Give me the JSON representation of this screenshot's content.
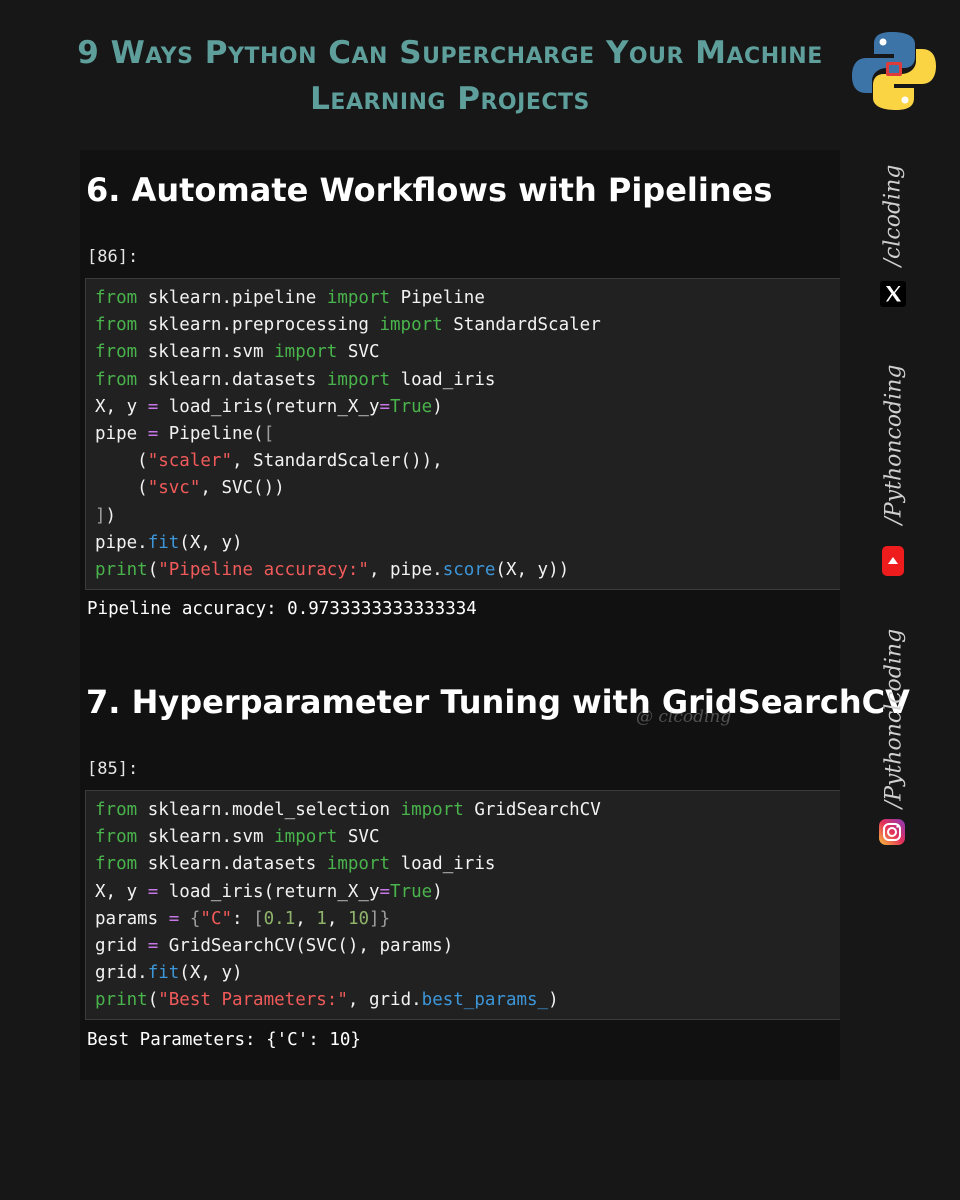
{
  "header": {
    "title": "9 Ways Python Can Supercharge Your Machine Learning Projects"
  },
  "sections": [
    {
      "heading": "6. Automate Workflows with Pipelines",
      "prompt": "[86]:",
      "output": "Pipeline accuracy: 0.9733333333333334",
      "code_lines": [
        [
          {
            "t": "from",
            "c": "kw"
          },
          {
            "t": " sklearn.pipeline "
          },
          {
            "t": "import",
            "c": "kw"
          },
          {
            "t": " Pipeline"
          }
        ],
        [
          {
            "t": "from",
            "c": "kw"
          },
          {
            "t": " sklearn.preprocessing "
          },
          {
            "t": "import",
            "c": "kw"
          },
          {
            "t": " StandardScaler"
          }
        ],
        [
          {
            "t": "from",
            "c": "kw"
          },
          {
            "t": " sklearn.svm "
          },
          {
            "t": "import",
            "c": "kw"
          },
          {
            "t": " SVC"
          }
        ],
        [
          {
            "t": "from",
            "c": "kw"
          },
          {
            "t": " sklearn.datasets "
          },
          {
            "t": "import",
            "c": "kw"
          },
          {
            "t": " load_iris"
          }
        ],
        [
          {
            "t": "X, y "
          },
          {
            "t": "=",
            "c": "op"
          },
          {
            "t": " load_iris(return_X_y"
          },
          {
            "t": "=",
            "c": "op"
          },
          {
            "t": "True",
            "c": "bool"
          },
          {
            "t": ")"
          }
        ],
        [
          {
            "t": "pipe "
          },
          {
            "t": "=",
            "c": "op"
          },
          {
            "t": " Pipeline("
          },
          {
            "t": "[",
            "c": "paren"
          }
        ],
        [
          {
            "t": "    ("
          },
          {
            "t": "\"scaler\"",
            "c": "str"
          },
          {
            "t": ", StandardScaler()),"
          }
        ],
        [
          {
            "t": "    ("
          },
          {
            "t": "\"svc\"",
            "c": "str"
          },
          {
            "t": ", SVC())"
          }
        ],
        [
          {
            "t": "]",
            "c": "paren"
          },
          {
            "t": ")"
          }
        ],
        [
          {
            "t": "pipe."
          },
          {
            "t": "fit",
            "c": "fn"
          },
          {
            "t": "(X, y)"
          }
        ],
        [
          {
            "t": "print",
            "c": "kw"
          },
          {
            "t": "("
          },
          {
            "t": "\"Pipeline accuracy:\"",
            "c": "str"
          },
          {
            "t": ", pipe."
          },
          {
            "t": "score",
            "c": "fn"
          },
          {
            "t": "(X, y))"
          }
        ]
      ]
    },
    {
      "heading": "7. Hyperparameter Tuning with GridSearchCV",
      "prompt": "[85]:",
      "output": "Best Parameters: {'C': 10}",
      "code_lines": [
        [
          {
            "t": "from",
            "c": "kw"
          },
          {
            "t": " sklearn.model_selection "
          },
          {
            "t": "import",
            "c": "kw"
          },
          {
            "t": " GridSearchCV"
          }
        ],
        [
          {
            "t": "from",
            "c": "kw"
          },
          {
            "t": " sklearn.svm "
          },
          {
            "t": "import",
            "c": "kw"
          },
          {
            "t": " SVC"
          }
        ],
        [
          {
            "t": "from",
            "c": "kw"
          },
          {
            "t": " sklearn.datasets "
          },
          {
            "t": "import",
            "c": "kw"
          },
          {
            "t": " load_iris"
          }
        ],
        [
          {
            "t": "X, y "
          },
          {
            "t": "=",
            "c": "op"
          },
          {
            "t": " load_iris(return_X_y"
          },
          {
            "t": "=",
            "c": "op"
          },
          {
            "t": "True",
            "c": "bool"
          },
          {
            "t": ")"
          }
        ],
        [
          {
            "t": "params "
          },
          {
            "t": "=",
            "c": "op"
          },
          {
            "t": " "
          },
          {
            "t": "{",
            "c": "paren"
          },
          {
            "t": "\"C\"",
            "c": "str"
          },
          {
            "t": ": "
          },
          {
            "t": "[",
            "c": "paren"
          },
          {
            "t": "0.1",
            "c": "num"
          },
          {
            "t": ", "
          },
          {
            "t": "1",
            "c": "num"
          },
          {
            "t": ", "
          },
          {
            "t": "10",
            "c": "num"
          },
          {
            "t": "]",
            "c": "paren"
          },
          {
            "t": "}",
            "c": "paren"
          }
        ],
        [
          {
            "t": "grid "
          },
          {
            "t": "=",
            "c": "op"
          },
          {
            "t": " GridSearchCV(SVC(), params)"
          }
        ],
        [
          {
            "t": "grid."
          },
          {
            "t": "fit",
            "c": "fn"
          },
          {
            "t": "(X, y)"
          }
        ],
        [
          {
            "t": "print",
            "c": "kw"
          },
          {
            "t": "("
          },
          {
            "t": "\"Best Parameters:\"",
            "c": "str"
          },
          {
            "t": ", grid."
          },
          {
            "t": "best_params_",
            "c": "fn"
          },
          {
            "t": ")"
          }
        ]
      ]
    }
  ],
  "watermark": "@ clcoding",
  "social": {
    "x": {
      "handle": "/clcoding",
      "icon": "x-logo-icon"
    },
    "youtube": {
      "handle": "/Pythoncoding",
      "icon": "youtube-icon"
    },
    "instagram": {
      "handle": "/Pythonclcoding",
      "icon": "instagram-icon"
    }
  },
  "colors": {
    "background": "#171717",
    "title": "#5e9f9c",
    "keyword": "#49b34c",
    "string": "#f05a5a",
    "operator": "#c777e6",
    "function": "#3d96d8",
    "number": "#8fb36b",
    "python_blue": "#3d74a8",
    "python_yellow": "#fbd444"
  }
}
